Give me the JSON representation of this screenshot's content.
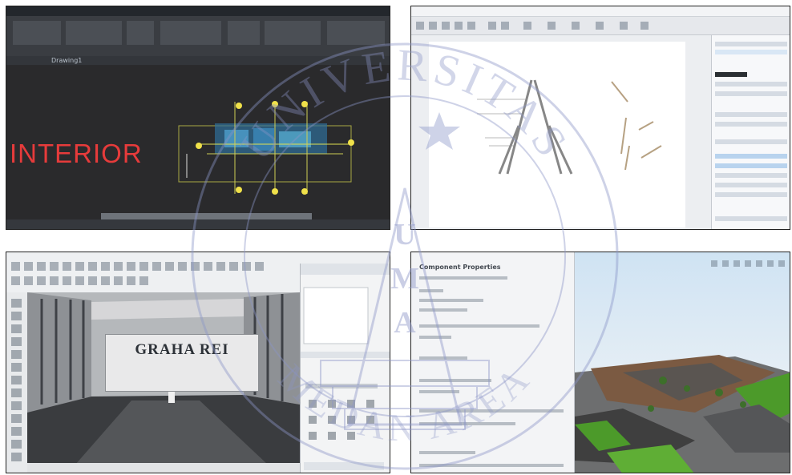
{
  "panels": {
    "cad": {
      "tab_label": "Drawing1",
      "canvas_text": "INTERIOR"
    },
    "sketchup": {
      "sign_title": "GRAHA REI"
    },
    "landscape": {
      "header_title": "Component Properties"
    }
  },
  "watermark": {
    "upper_text": "UNIVERSITAS",
    "center_letters": [
      "U",
      "M",
      "A"
    ],
    "lower_text": "MEDAN AREA"
  },
  "colors": {
    "cad_text_red": "#e63b3b",
    "cad_background": "#2b2b2d",
    "watermark_blue": "#8b95c7",
    "grass_green": "#4c9a2a"
  }
}
